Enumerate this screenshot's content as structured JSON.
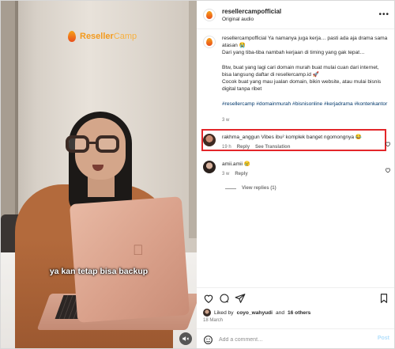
{
  "video": {
    "logo_bold": "Reseller",
    "logo_light": "Camp",
    "subtitle": "ya kan tetap bisa backup",
    "mute_icon": "speaker-muted-icon"
  },
  "post": {
    "username": "resellercampofficial",
    "audio": "Original audio",
    "more_icon": "more-options-icon",
    "caption": {
      "username": "resellercampofficial",
      "line1": "Ya namanya juga kerja… pasti ada aja drama sama atasan 😭",
      "line2": "Dari yang tiba-tiba nambah kerjaan di timing yang gak tepat…",
      "para2": "Btw, buat yang lagi cari domain murah buat mulai cuan dari internet, bisa langsung daftar di resellercamp.id 🚀",
      "para2b": "Cocok buat yang mau jualan domain, bikin website, atau mulai bisnis digital tanpa ribet",
      "hashtags": "#resellercamp #domainmurah #bisnisonline #kerjadrama #kontenkantor",
      "time": "3 w"
    },
    "comments": [
      {
        "username": "rakhma_anggun",
        "text": "Vibes ibu² komplek banget ngomongnya 😂",
        "time": "19 h",
        "reply": "Reply",
        "see_translation": "See Translation"
      },
      {
        "username": "amii.amii",
        "text": "😢",
        "time": "3 w",
        "reply": "Reply",
        "view_replies": "View replies (1)"
      }
    ],
    "actions": {
      "like_icon": "heart-icon",
      "comment_icon": "comment-icon",
      "share_icon": "share-icon",
      "save_icon": "bookmark-icon"
    },
    "likes": {
      "prefix": "Liked by",
      "user": "coyo_wahyudi",
      "and": "and",
      "others": "16 others"
    },
    "date": "18 March",
    "comment_box": {
      "placeholder": "Add a comment…",
      "post_label": "Post",
      "emoji_icon": "emoji-icon"
    }
  },
  "colors": {
    "highlight_border": "#e3262a",
    "hashtag": "#00376b",
    "muted_text": "#737373",
    "post_button": "#b2dffc"
  }
}
